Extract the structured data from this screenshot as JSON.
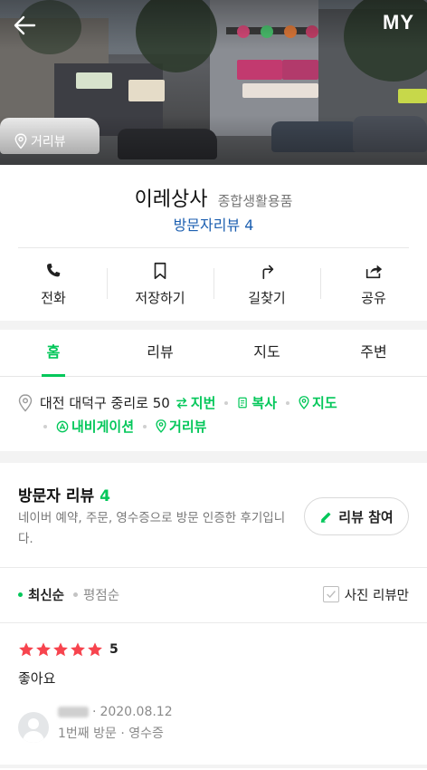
{
  "header": {
    "back_icon": "arrow-left-icon",
    "my_label": "MY",
    "streetview_label": "거리뷰"
  },
  "place": {
    "name": "이레상사",
    "category": "종합생활용품",
    "visitor_review_link": "방문자리뷰 4"
  },
  "actions": [
    {
      "label": "전화",
      "icon": "phone-icon"
    },
    {
      "label": "저장하기",
      "icon": "bookmark-icon"
    },
    {
      "label": "길찾기",
      "icon": "directions-icon"
    },
    {
      "label": "공유",
      "icon": "share-icon"
    }
  ],
  "tabs": [
    {
      "label": "홈",
      "active": true
    },
    {
      "label": "리뷰",
      "active": false
    },
    {
      "label": "지도",
      "active": false
    },
    {
      "label": "주변",
      "active": false
    }
  ],
  "address": {
    "text": "대전 대덕구 중리로 50",
    "links": {
      "lot_number": "지번",
      "copy": "복사",
      "map": "지도",
      "navigation": "내비게이션",
      "streetview": "거리뷰"
    }
  },
  "reviews": {
    "title": "방문자 리뷰",
    "count": "4",
    "description": "네이버 예약, 주문, 영수증으로 방문 인증한 후기입니다.",
    "write_button": "리뷰 참여",
    "sort_options": [
      "최신순",
      "평점순"
    ],
    "photo_only_label": "사진 리뷰만",
    "items": [
      {
        "rating": "5",
        "text": "좋아요",
        "date": "2020.08.12",
        "visit_info": "1번째 방문 · 영수증"
      }
    ]
  },
  "colors": {
    "accent": "#03c75a",
    "link_blue": "#1c5fb0",
    "star_red": "#f7444e"
  }
}
